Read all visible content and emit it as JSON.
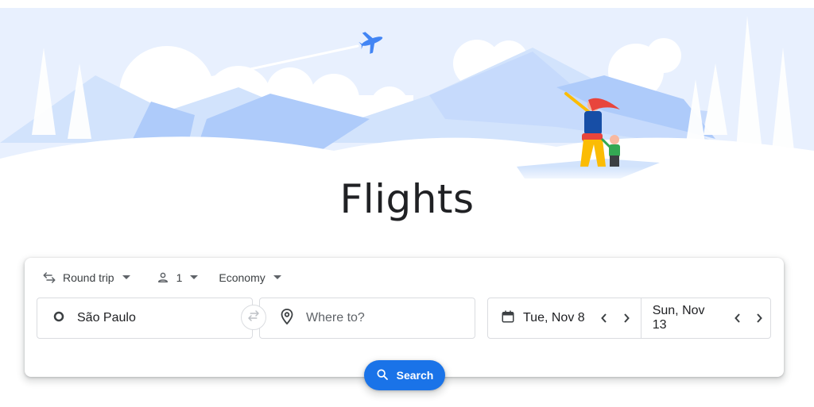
{
  "page": {
    "title": "Flights"
  },
  "trip_options": {
    "trip_type": "Round trip",
    "passengers": "1",
    "cabin_class": "Economy"
  },
  "search": {
    "origin": "São Paulo",
    "destination_placeholder": "Where to?",
    "departure_date": "Tue, Nov 8",
    "return_date": "Sun, Nov 13",
    "button_label": "Search"
  },
  "icons": {
    "trip_type": "swap-arrows-icon",
    "passengers": "person-icon",
    "dropdown": "caret-down-icon",
    "origin": "circle-outline-icon",
    "destination": "location-pin-icon",
    "swap": "swap-horizontal-icon",
    "calendar": "calendar-icon",
    "prev": "chevron-left-icon",
    "next": "chevron-right-icon",
    "search": "search-icon"
  },
  "colors": {
    "accent": "#1a73e8",
    "sky": "#e8f0fe",
    "mountain": "#aecbfa",
    "text": "#3c4043"
  }
}
